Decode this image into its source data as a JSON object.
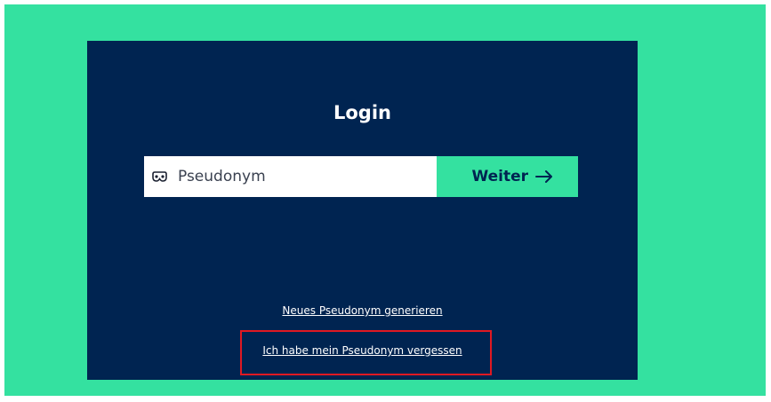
{
  "login": {
    "title": "Login",
    "pseudonym_placeholder": "Pseudonym",
    "pseudonym_value": "",
    "mask_icon": "mask-icon",
    "weiter_label": "Weiter",
    "arrow_icon": "arrow-right-icon",
    "generate_link": "Neues Pseudonym generieren",
    "forgot_link": "Ich habe mein Pseudonym vergessen"
  },
  "colors": {
    "background": "#34e1a0",
    "card": "#002451",
    "accent": "#34e1a0",
    "highlight": "#e01922"
  }
}
